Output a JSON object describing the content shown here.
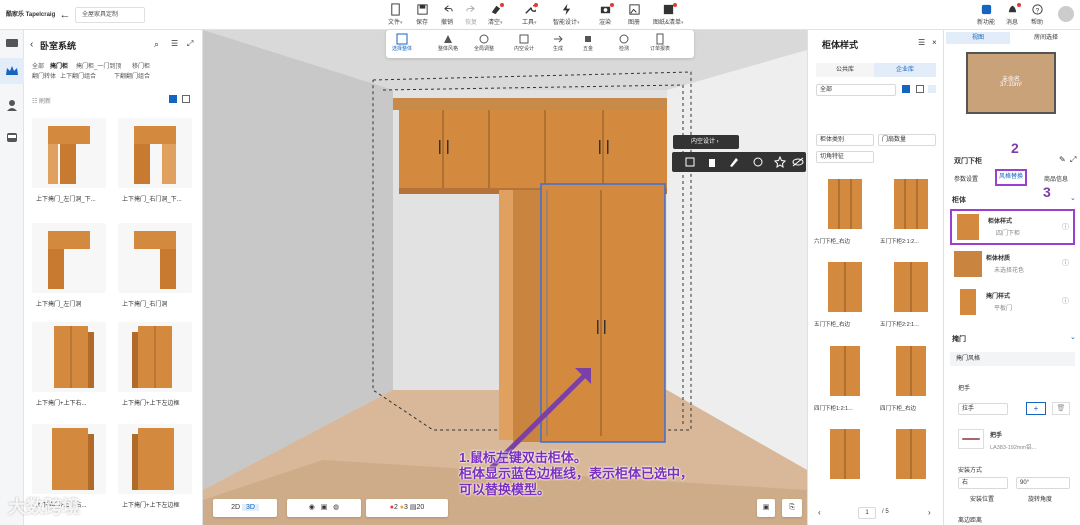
{
  "topbar": {
    "brand": "酷家乐 Tapelcraig",
    "project": "全屋家具定制",
    "tools": [
      "文件",
      "保存",
      "撤销",
      "恢复",
      "清空",
      "工具",
      "智能设计",
      "渲染",
      "图册",
      "图纸&清单"
    ],
    "right": [
      "新功能",
      "消息",
      "帮助"
    ]
  },
  "leftpanel": {
    "title": "卧室系统",
    "tabs_row1": [
      "全部",
      "掩门柜",
      "掩门柜_一门到顶",
      "移门柜"
    ],
    "tabs_row2": [
      "翻门转体",
      "上下翻门组合",
      "下翻翻门组合"
    ],
    "refresh": "刷新",
    "items": [
      {
        "label": "上下掩门_左门洞_下..."
      },
      {
        "label": "上下掩门_右门洞_下..."
      },
      {
        "label": "上下掩门_左门洞"
      },
      {
        "label": "上下掩门_右门洞"
      },
      {
        "label": "上下掩门+上下右..."
      },
      {
        "label": "上下掩门+上下左边框"
      },
      {
        "label": "上下掩门+上下右..."
      },
      {
        "label": "上下掩门+上下左边框"
      }
    ]
  },
  "float_toolbar": [
    "选择整体",
    "整体风格",
    "全局调整",
    "内空设计",
    "生成",
    "五金",
    "检测",
    "订单报表"
  ],
  "inner_design": "内空设计",
  "viewport_bottom": {
    "mode_2d": "2D",
    "mode_3d": "3D",
    "err_count": "2",
    "warn_count": "3",
    "page_count": "20"
  },
  "style_panel": {
    "title": "柜体样式",
    "tab_public": "公共库",
    "tab_enterprise": "企业库",
    "filter_all": "全部",
    "filter_type": "柜体类别",
    "filter_doors": "门扇数量",
    "filter_cut": "切角特征",
    "items": [
      {
        "label": "六门下柜_右边"
      },
      {
        "label": "五门下柜2:1:2..."
      },
      {
        "label": "五门下柜_右边"
      },
      {
        "label": "五门下柜2:2:1..."
      },
      {
        "label": "四门下柜1:2:1..."
      },
      {
        "label": "四门下柜_右边"
      },
      {
        "label": "",
        "pad": true
      },
      {
        "label": "",
        "pad": true
      }
    ],
    "page": "1",
    "total": "/ 5"
  },
  "right": {
    "view_tab": "视图",
    "room_tab": "房间选择",
    "room_name": "未命名",
    "room_area": "37.10m²",
    "object_title": "双门下柜",
    "tabs": [
      "参数设置",
      "风格替换",
      "商品信息"
    ],
    "section_cabinet": "柜体",
    "props": [
      {
        "name": "柜体样式",
        "value": "四门下柜"
      },
      {
        "name": "柜体材质",
        "value": "未选择花色"
      },
      {
        "name": "掩门样式",
        "value": "平板门"
      }
    ],
    "section_door": "掩门",
    "door_style": "掩门风格",
    "handle_title": "把手",
    "handle_type": "拉手",
    "handle_name": "把手",
    "handle_code": "LA383-192mm铝...",
    "install": "安装方式",
    "install_side": "右",
    "angle": "90°",
    "install_pos": "安装位置",
    "rot": "旋转角度",
    "edge": "离边距离"
  },
  "annotations": {
    "num2": "2",
    "num3": "3",
    "line1": "1.鼠标左键双击柜体。",
    "line2": "柜体显示蓝色边框线，表示柜体已选中，",
    "line3": "可以替换模型。",
    "watermark": "大数跨境"
  },
  "colors": {
    "accent": "#1565c0",
    "purple": "#7b3fa8",
    "wood": "#d48a3e"
  }
}
